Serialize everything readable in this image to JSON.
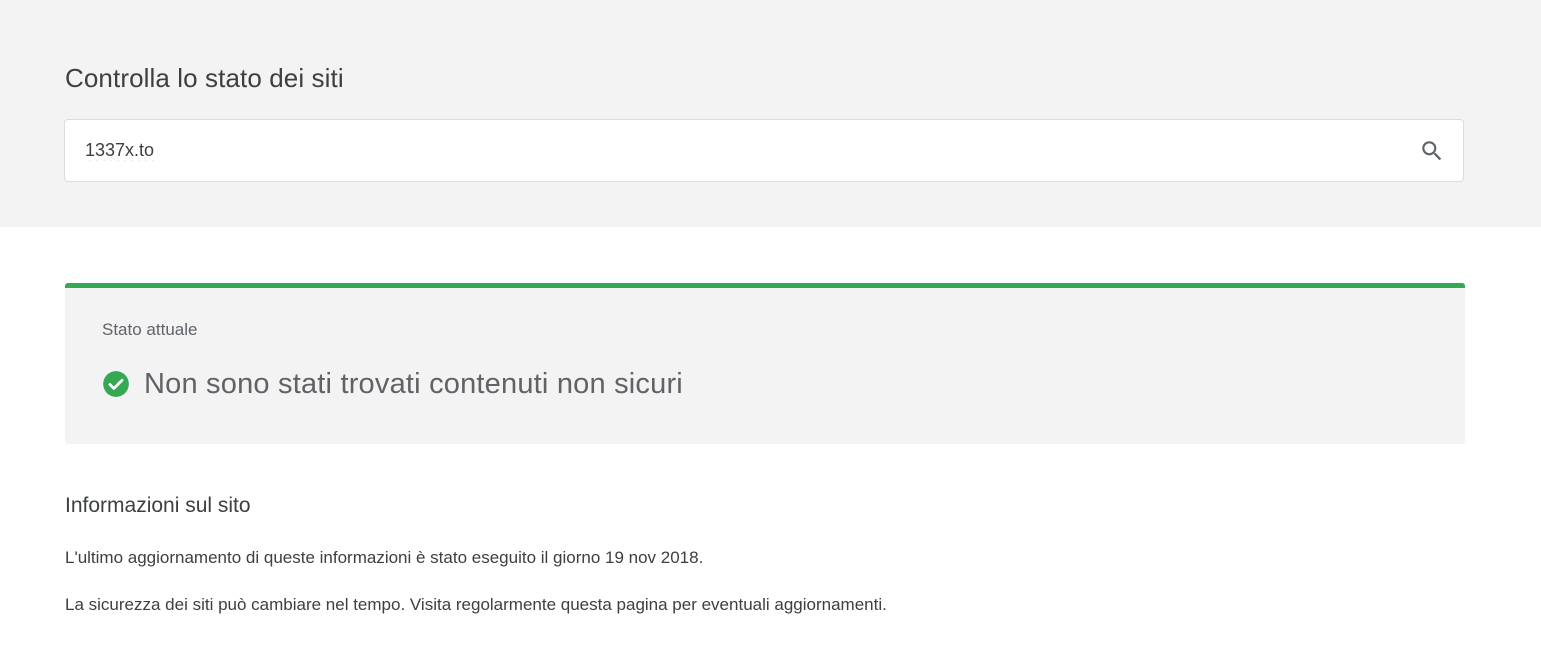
{
  "header": {
    "title": "Controlla lo stato dei siti"
  },
  "search": {
    "value": "1337x.to",
    "icon": "search-icon"
  },
  "status": {
    "label": "Stato attuale",
    "message": "Non sono stati trovati contenuti non sicuri",
    "icon": "check-circle-icon",
    "accent_color": "#34a853"
  },
  "site_info": {
    "title": "Informazioni sul sito",
    "last_updated": "L'ultimo aggiornamento di queste informazioni è stato eseguito il giorno 19 nov 2018.",
    "note": "La sicurezza dei siti può cambiare nel tempo. Visita regolarmente questa pagina per eventuali aggiornamenti."
  }
}
